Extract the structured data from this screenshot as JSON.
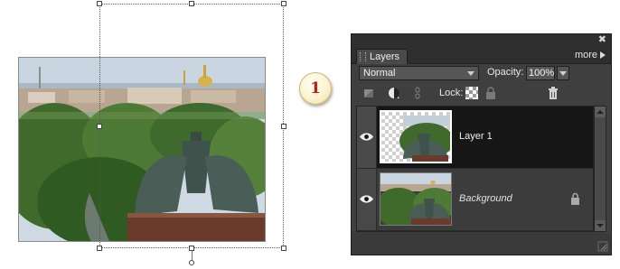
{
  "step_badge": {
    "label": "1"
  },
  "canvas": {
    "photo_description_icon": "city-photo-icon"
  },
  "layers_panel": {
    "close_glyph": "✖",
    "tab_label": "Layers",
    "more_label": "more",
    "blend_mode": "Normal",
    "opacity_label": "Opacity:",
    "opacity_value": "100%",
    "lock_label": "Lock:",
    "layers": [
      {
        "name": "Layer 1",
        "selected": true,
        "visible": true,
        "locked": false
      },
      {
        "name": "Background",
        "selected": false,
        "visible": true,
        "locked": true
      }
    ]
  },
  "colors": {
    "panel_bg": "#3f3f3f",
    "selected_row": "#161616",
    "badge_number": "#c31818"
  }
}
